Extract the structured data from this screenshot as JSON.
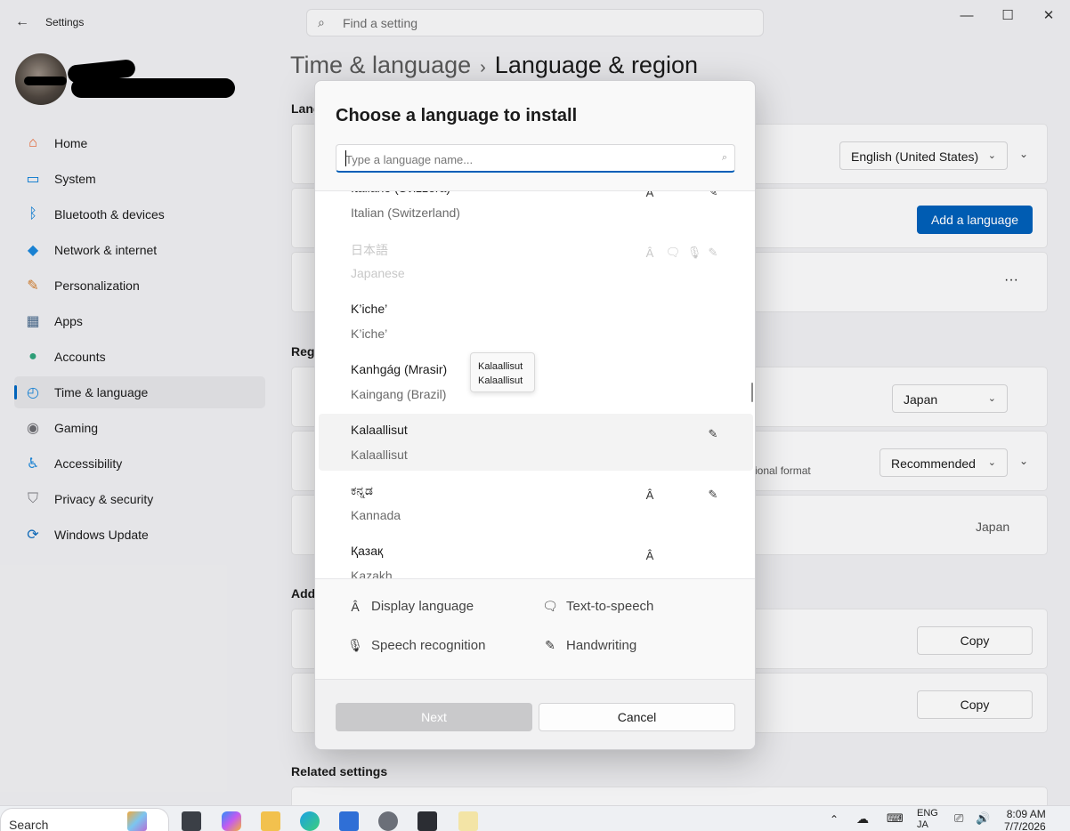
{
  "window": {
    "app_title": "Settings",
    "search_placeholder": "Find a setting",
    "minimize": "—",
    "maximize": "☐",
    "close": "✕"
  },
  "nav": {
    "items": [
      {
        "label": "Home",
        "icon": "home-icon",
        "color": "#e8612c"
      },
      {
        "label": "System",
        "icon": "system-icon",
        "color": "#0078d4"
      },
      {
        "label": "Bluetooth & devices",
        "icon": "bluetooth-icon",
        "color": "#0078d4"
      },
      {
        "label": "Network & internet",
        "icon": "wifi-icon",
        "color": "#1a86d9"
      },
      {
        "label": "Personalization",
        "icon": "brush-icon",
        "color": "#d07b2b"
      },
      {
        "label": "Apps",
        "icon": "apps-icon",
        "color": "#4a6a8c"
      },
      {
        "label": "Accounts",
        "icon": "accounts-icon",
        "color": "#2fa37b"
      },
      {
        "label": "Time & language",
        "icon": "globe-clock-icon",
        "color": "#1a86d9"
      },
      {
        "label": "Gaming",
        "icon": "gamepad-icon",
        "color": "#6b6b70"
      },
      {
        "label": "Accessibility",
        "icon": "accessibility-icon",
        "color": "#1a86d9"
      },
      {
        "label": "Privacy & security",
        "icon": "shield-icon",
        "color": "#7a7a80"
      },
      {
        "label": "Windows Update",
        "icon": "update-icon",
        "color": "#0f6cbd"
      }
    ]
  },
  "page": {
    "breadcrumb_parent": "Time & language",
    "breadcrumb_current": "Language & region",
    "section_language": "Lang",
    "windows_display_language_value": "English (United States)",
    "add_language_button": "Add a language",
    "section_region": "Regi",
    "country_value": "Japan",
    "regional_format_value": "Recommended",
    "regional_format_hint": "ional format",
    "region_readout": "Japan",
    "section_additional": "Add",
    "copy_button_1": "Copy",
    "copy_button_2": "Copy",
    "section_related": "Related settings",
    "more_label": "···"
  },
  "dialog": {
    "title": "Choose a language to install",
    "search_placeholder": "Type a language name...",
    "languages": [
      {
        "native": "Italiano (Svizzera)",
        "english": "Italian (Switzerland)",
        "display": true,
        "tts": false,
        "speech": false,
        "handwriting": true,
        "disabled": false,
        "hover": false
      },
      {
        "native": "日本語",
        "english": "Japanese",
        "display": true,
        "tts": true,
        "speech": true,
        "handwriting": true,
        "disabled": true,
        "hover": false
      },
      {
        "native": "K’iche’",
        "english": "K’iche’",
        "display": false,
        "tts": false,
        "speech": false,
        "handwriting": false,
        "disabled": false,
        "hover": false
      },
      {
        "native": "Kanhgág (Mrasir)",
        "english": "Kaingang (Brazil)",
        "display": false,
        "tts": false,
        "speech": false,
        "handwriting": false,
        "disabled": false,
        "hover": false
      },
      {
        "native": "Kalaallisut",
        "english": "Kalaallisut",
        "display": false,
        "tts": false,
        "speech": false,
        "handwriting": true,
        "disabled": false,
        "hover": true
      },
      {
        "native": "ಕನ್ನಡ",
        "english": "Kannada",
        "display": true,
        "tts": false,
        "speech": false,
        "handwriting": true,
        "disabled": false,
        "hover": false
      },
      {
        "native": "Қазақ",
        "english": "Kazakh",
        "display": true,
        "tts": false,
        "speech": false,
        "handwriting": false,
        "disabled": false,
        "hover": false
      }
    ],
    "tooltip_line1": "Kalaallisut",
    "tooltip_line2": "Kalaallisut",
    "legend": {
      "display_language": "Display language",
      "text_to_speech": "Text-to-speech",
      "speech_recognition": "Speech recognition",
      "handwriting": "Handwriting"
    },
    "next_button": "Next",
    "cancel_button": "Cancel"
  },
  "taskbar": {
    "search_label": "Search",
    "lang_top": "ENG",
    "lang_bottom": "JA",
    "time": "8:09 AM",
    "date": "7/7/2026"
  }
}
